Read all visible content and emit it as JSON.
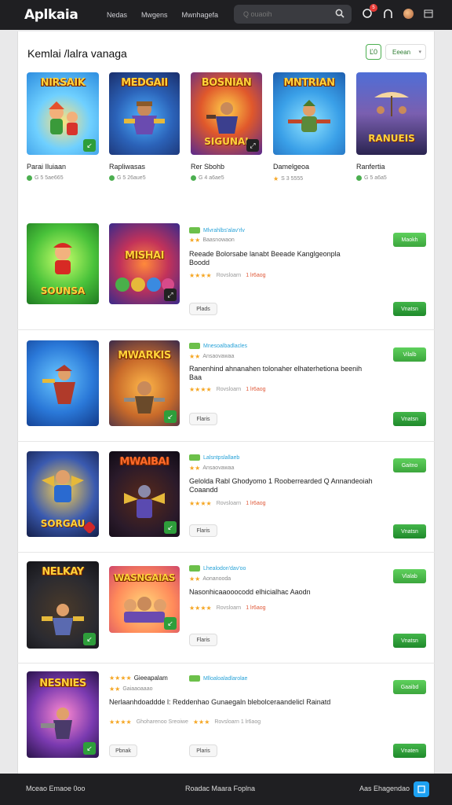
{
  "header": {
    "logo": "Aplkaia",
    "nav": [
      "Nedas",
      "Mwgens",
      "Mwnhagefa"
    ],
    "search_placeholder": "Q ouaoih",
    "notif_count": "5"
  },
  "featured": {
    "title": "Kemlai /lalra vanaga",
    "filter_label": "Ľ0",
    "sort_label": "Eeean",
    "items": [
      {
        "art": "NIRSAIK",
        "name": "Parai Iluiaan",
        "rating": "G 5 5ae665",
        "icon": "dot"
      },
      {
        "art": "MEDGAII",
        "name": "Rapliwasas",
        "rating": "G 5 26aue5",
        "icon": "dot"
      },
      {
        "art": "BOSNIAN",
        "art2": "SIGUNAI",
        "name": "Rer Sbohb",
        "rating": "G 4 a6ae5",
        "icon": "dot"
      },
      {
        "art": "MNTRIAN",
        "name": "Damelgeoa",
        "rating": "S 3 5555",
        "icon": "star"
      },
      {
        "art": "",
        "art2": "RANUEIS",
        "name": "Ranfertia",
        "rating": "G 5 a6a5",
        "icon": "dot"
      }
    ]
  },
  "list": [
    {
      "art1": "SOUNSA",
      "art2": "MISHAI",
      "tag": "Mlvrahlbs'alav'rlv",
      "stars_text": "Baasnowaon",
      "desc": "Reeade Bolorsabe lanabt Beeade Kanglgeonpla Boodd",
      "rate1": "Rovsloarn",
      "rate2": "1 lr6aog",
      "pill": "Plads",
      "btn_top": "Maokh",
      "btn_bottom": "Vnatsn"
    },
    {
      "art1": "",
      "art2": "MWARKIS",
      "tag": "Mnesoalbadlacles",
      "stars_text": "Ansaovawaa",
      "desc": "Ranenhind ahnanahen tolonaher elhaterhetiona beenih Baa",
      "rate1": "Rovsloarn",
      "rate2": "1 lr6aog",
      "pill": "Flaris",
      "btn_top": "Vilalb",
      "btn_bottom": "Vnatsn"
    },
    {
      "art1": "SORGAU",
      "art2": "MWAIBAI",
      "tag": "Lalsntpslallaeb",
      "stars_text": "Ansaovawaa",
      "desc": "Gelolda Rabl Ghodyomo 1 Rooberrearded Q Annandeoiah Coaandd",
      "rate1": "Rovsloarn",
      "rate2": "1 lr6aog",
      "pill": "Flaris",
      "btn_top": "Gaitno",
      "btn_bottom": "Vnatsn"
    },
    {
      "art1": "NELKAY",
      "art2": "WASNGAIAS",
      "tag": "Lhealodon'dav'oo",
      "stars_text": "Aonanooda",
      "desc": "Nasonhicaaooocodd elhicialhac Aaodn",
      "rate1": "Rovsloarn",
      "rate2": "1 lr6aog",
      "pill": "Flaris",
      "btn_top": "Vlalab",
      "btn_bottom": "Vnatsn"
    },
    {
      "art1": "NESNIES",
      "art2": "",
      "tag_left": "Gieeapalam",
      "tag_right": "Mlloaloaladlarolae",
      "stars_text": "Gaiaaoaaao",
      "desc": "Nerlaanhdoaddde l: Reddenhao Gunaegaln blebolceraandelicl Rainatd",
      "rate1": "Ghoharenoo Sreoiwe",
      "rate2": "Rovsloarn 1 lr6aog",
      "pill_left": "Pbnak",
      "pill": "Plaris",
      "btn_top": "Gaaibd",
      "btn_bottom": "Vnaten"
    }
  ],
  "footer": {
    "left": "Mceao Emaoe 0oo",
    "center": "Roadac Maara Foplna",
    "right": "Aas Ehagendao"
  },
  "colors": {
    "accent_green": "#3ca63d",
    "link_blue": "#29a3d8",
    "star": "#f5a623",
    "dark_bar": "#1f1f22"
  }
}
